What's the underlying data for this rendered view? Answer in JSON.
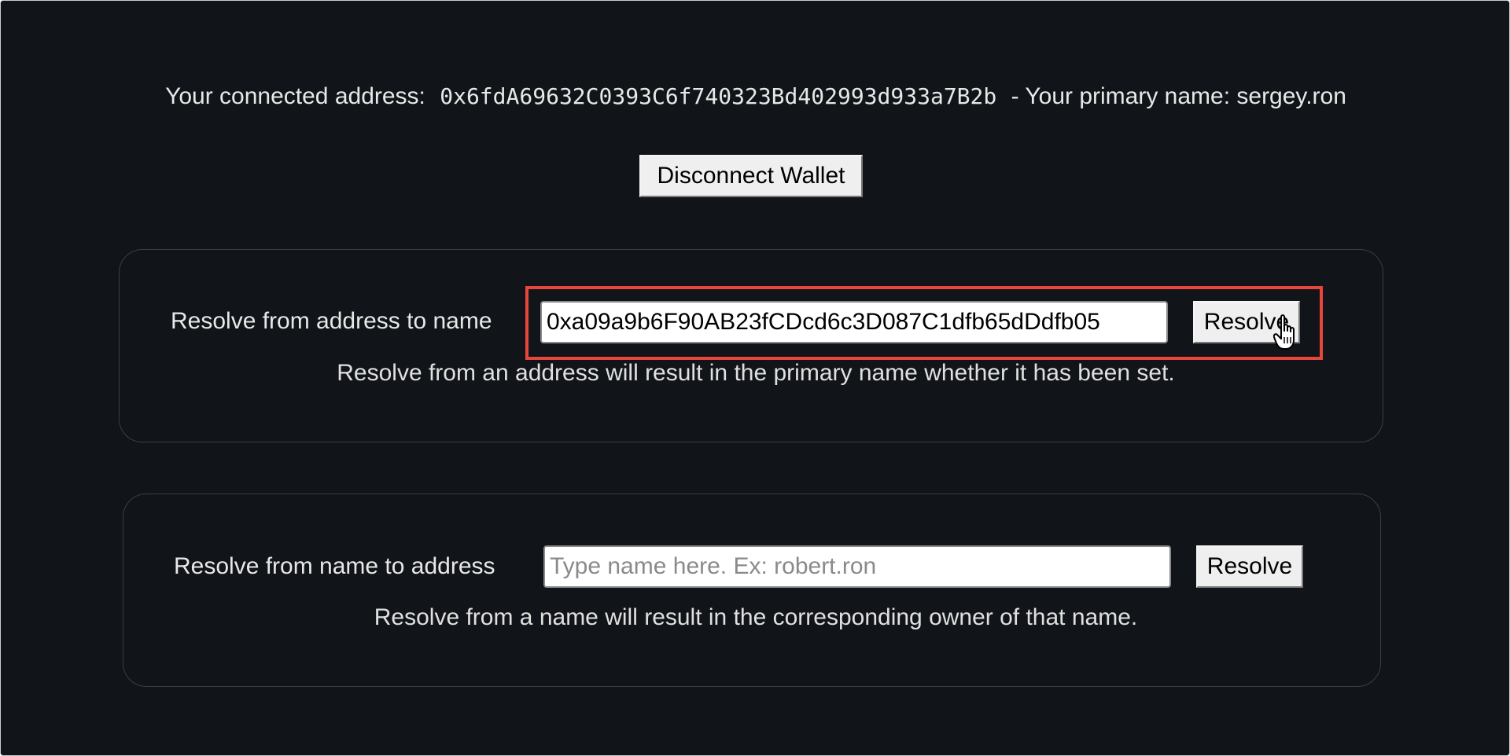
{
  "header": {
    "connected_label": "Your connected address:",
    "address": "0x6fdA69632C0393C6f740323Bd402993d933a7B2b",
    "primary_label": "- Your primary name: sergey.ron"
  },
  "disconnect_label": "Disconnect Wallet",
  "address_to_name": {
    "label": "Resolve from address to name",
    "input_value": "0xa09a9b6F90AB23fCDcd6c3D087C1dfb65dDdfb05",
    "button_label": "Resolve",
    "hint": "Resolve from an address will result in the primary name whether it has been set."
  },
  "name_to_address": {
    "label": "Resolve from name to address",
    "input_value": "",
    "placeholder": "Type name here. Ex: robert.ron",
    "button_label": "Resolve",
    "hint": "Resolve from a name will result in the corresponding owner of that name."
  },
  "colors": {
    "background": "#111418",
    "highlight": "#e8453c"
  },
  "icons": {
    "cursor": "hand-pointer-icon"
  }
}
